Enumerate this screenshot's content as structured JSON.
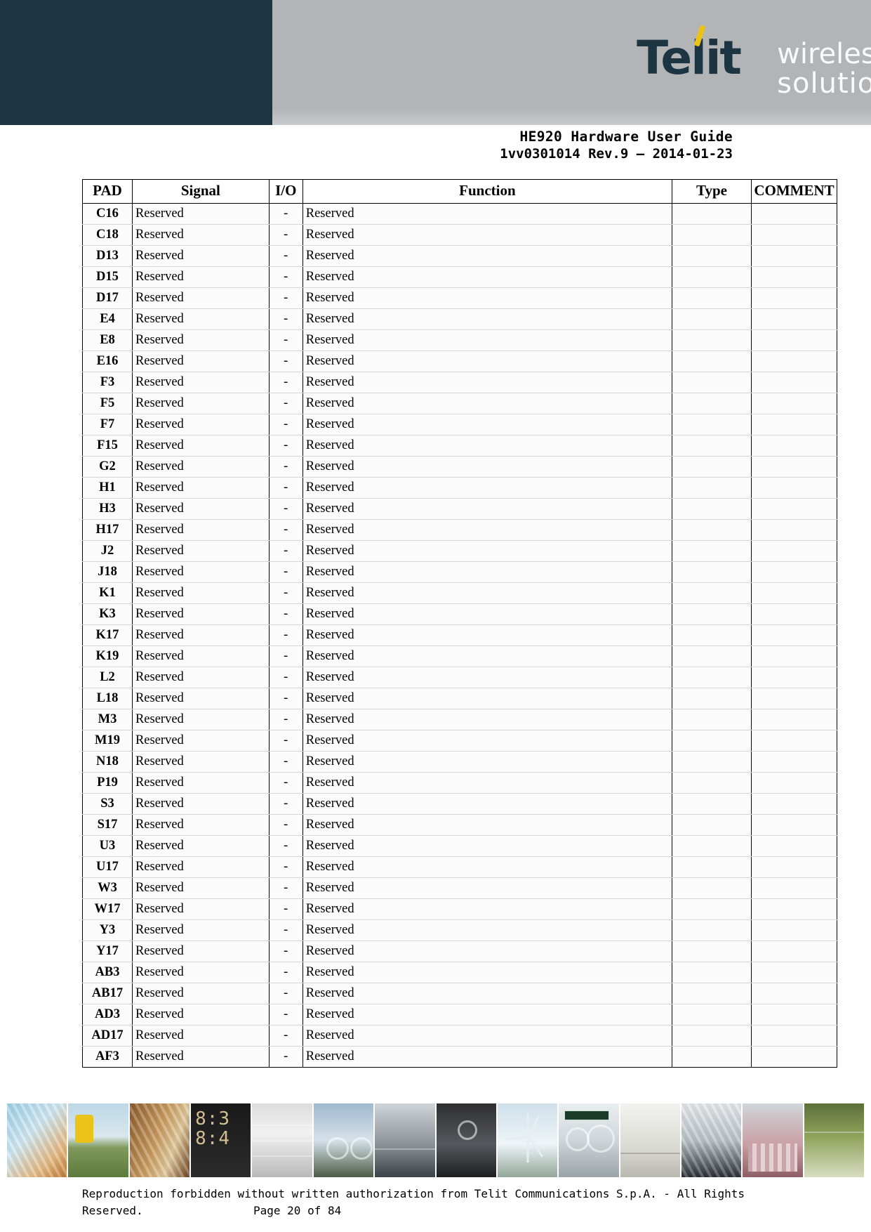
{
  "header": {
    "logo_wordmark": "Telit",
    "logo_line1": "wireless",
    "logo_line2": "solutions"
  },
  "document": {
    "title": "HE920 Hardware User Guide",
    "subtitle": "1vv0301014 Rev.9 – 2014-01-23"
  },
  "table": {
    "columns": [
      "PAD",
      "Signal",
      "I/O",
      "Function",
      "Type",
      "COMMENT"
    ],
    "rows": [
      [
        "C16",
        "Reserved",
        "-",
        "Reserved",
        "",
        ""
      ],
      [
        "C18",
        "Reserved",
        "-",
        "Reserved",
        "",
        ""
      ],
      [
        "D13",
        "Reserved",
        "-",
        "Reserved",
        "",
        ""
      ],
      [
        "D15",
        "Reserved",
        "-",
        "Reserved",
        "",
        ""
      ],
      [
        "D17",
        "Reserved",
        "-",
        "Reserved",
        "",
        ""
      ],
      [
        "E4",
        "Reserved",
        "-",
        "Reserved",
        "",
        ""
      ],
      [
        "E8",
        "Reserved",
        "-",
        "Reserved",
        "",
        ""
      ],
      [
        "E16",
        "Reserved",
        "-",
        "Reserved",
        "",
        ""
      ],
      [
        "F3",
        "Reserved",
        "-",
        "Reserved",
        "",
        ""
      ],
      [
        "F5",
        "Reserved",
        "-",
        "Reserved",
        "",
        ""
      ],
      [
        "F7",
        "Reserved",
        "-",
        "Reserved",
        "",
        ""
      ],
      [
        "F15",
        "Reserved",
        "-",
        "Reserved",
        "",
        ""
      ],
      [
        "G2",
        "Reserved",
        "-",
        "Reserved",
        "",
        ""
      ],
      [
        "H1",
        "Reserved",
        "-",
        "Reserved",
        "",
        ""
      ],
      [
        "H3",
        "Reserved",
        "-",
        "Reserved",
        "",
        ""
      ],
      [
        "H17",
        "Reserved",
        "-",
        "Reserved",
        "",
        ""
      ],
      [
        "J2",
        "Reserved",
        "-",
        "Reserved",
        "",
        ""
      ],
      [
        "J18",
        "Reserved",
        "-",
        "Reserved",
        "",
        ""
      ],
      [
        "K1",
        "Reserved",
        "-",
        "Reserved",
        "",
        ""
      ],
      [
        "K3",
        "Reserved",
        "-",
        "Reserved",
        "",
        ""
      ],
      [
        "K17",
        "Reserved",
        "-",
        "Reserved",
        "",
        ""
      ],
      [
        "K19",
        "Reserved",
        "-",
        "Reserved",
        "",
        ""
      ],
      [
        "L2",
        "Reserved",
        "-",
        "Reserved",
        "",
        ""
      ],
      [
        "L18",
        "Reserved",
        "-",
        "Reserved",
        "",
        ""
      ],
      [
        "M3",
        "Reserved",
        "-",
        "Reserved",
        "",
        ""
      ],
      [
        "M19",
        "Reserved",
        "-",
        "Reserved",
        "",
        ""
      ],
      [
        "N18",
        "Reserved",
        "-",
        "Reserved",
        "",
        ""
      ],
      [
        "P19",
        "Reserved",
        "-",
        "Reserved",
        "",
        ""
      ],
      [
        "S3",
        "Reserved",
        "-",
        "Reserved",
        "",
        ""
      ],
      [
        "S17",
        "Reserved",
        "-",
        "Reserved",
        "",
        ""
      ],
      [
        "U3",
        "Reserved",
        "-",
        "Reserved",
        "",
        ""
      ],
      [
        "U17",
        "Reserved",
        "-",
        "Reserved",
        "",
        ""
      ],
      [
        "W3",
        "Reserved",
        "-",
        "Reserved",
        "",
        ""
      ],
      [
        "W17",
        "Reserved",
        "-",
        "Reserved",
        "",
        ""
      ],
      [
        "Y3",
        "Reserved",
        "-",
        "Reserved",
        "",
        ""
      ],
      [
        "Y17",
        "Reserved",
        "-",
        "Reserved",
        "",
        ""
      ],
      [
        "AB3",
        "Reserved",
        "-",
        "Reserved",
        "",
        ""
      ],
      [
        "AB17",
        "Reserved",
        "-",
        "Reserved",
        "",
        ""
      ],
      [
        "AD3",
        "Reserved",
        "-",
        "Reserved",
        "",
        ""
      ],
      [
        "AD17",
        "Reserved",
        "-",
        "Reserved",
        "",
        ""
      ],
      [
        "AF3",
        "Reserved",
        "-",
        "Reserved",
        "",
        ""
      ]
    ]
  },
  "footer": {
    "line1": "Reproduction forbidden without written authorization from Telit Communications S.p.A. - All Rights",
    "reserved": "Reserved.",
    "page": "Page 20 of 84"
  }
}
